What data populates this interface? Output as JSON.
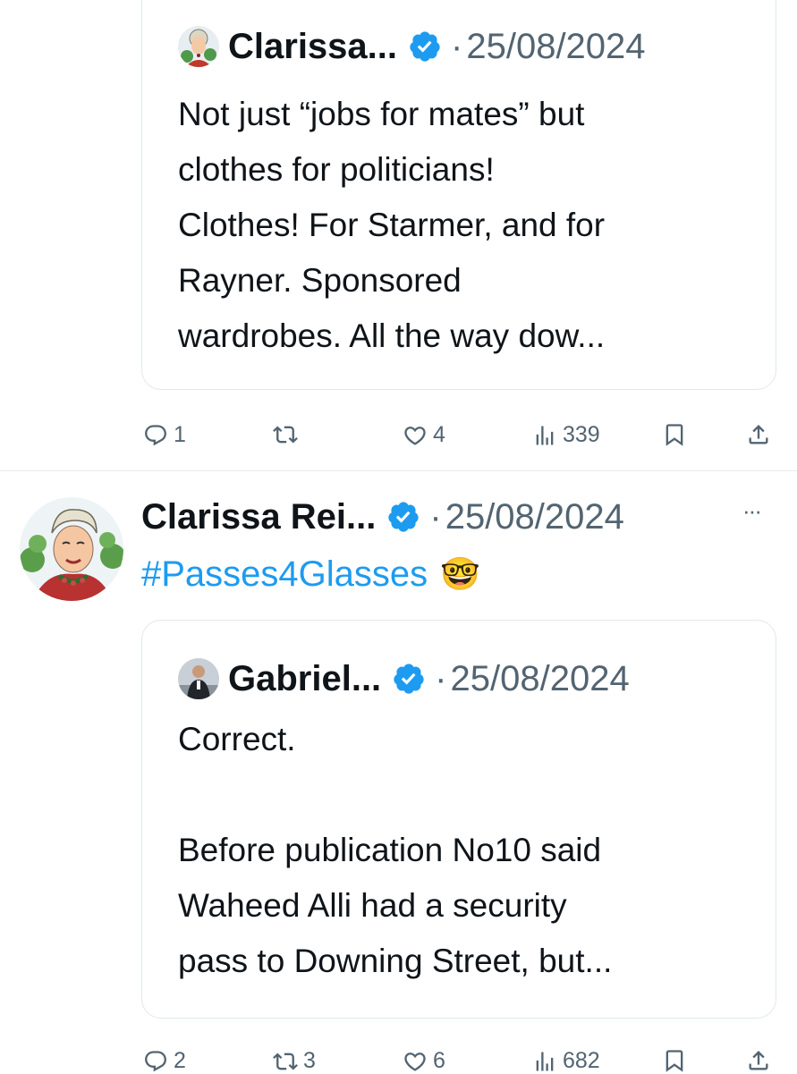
{
  "colors": {
    "text": "#0f1419",
    "secondary": "#536471",
    "link": "#1d9bf0",
    "border": "#e1e8ed"
  },
  "post1": {
    "quoted": {
      "author": "Clarissa...",
      "verified_icon": "verified-badge-icon",
      "separator": "·",
      "date": "25/08/2024",
      "text": "Not just “jobs for mates” but\nclothes for politicians!\nClothes! For Starmer, and for\nRayner. Sponsored\nwardrobes. All the way dow..."
    },
    "actions": {
      "replies": "1",
      "reposts": "",
      "likes": "4",
      "views": "339"
    }
  },
  "post2": {
    "author": "Clarissa Rei...",
    "separator": "·",
    "date": "25/08/2024",
    "more_label": "···",
    "hashtag": "#Passes4Glasses",
    "emoji": "🤓",
    "quoted": {
      "author": "Gabriel...",
      "separator": "·",
      "date": "25/08/2024",
      "text": "Correct.\n\nBefore publication No10 said\nWaheed Alli had a security\npass to Downing Street, but..."
    },
    "actions": {
      "replies": "2",
      "reposts": "3",
      "likes": "6",
      "views": "682"
    }
  }
}
